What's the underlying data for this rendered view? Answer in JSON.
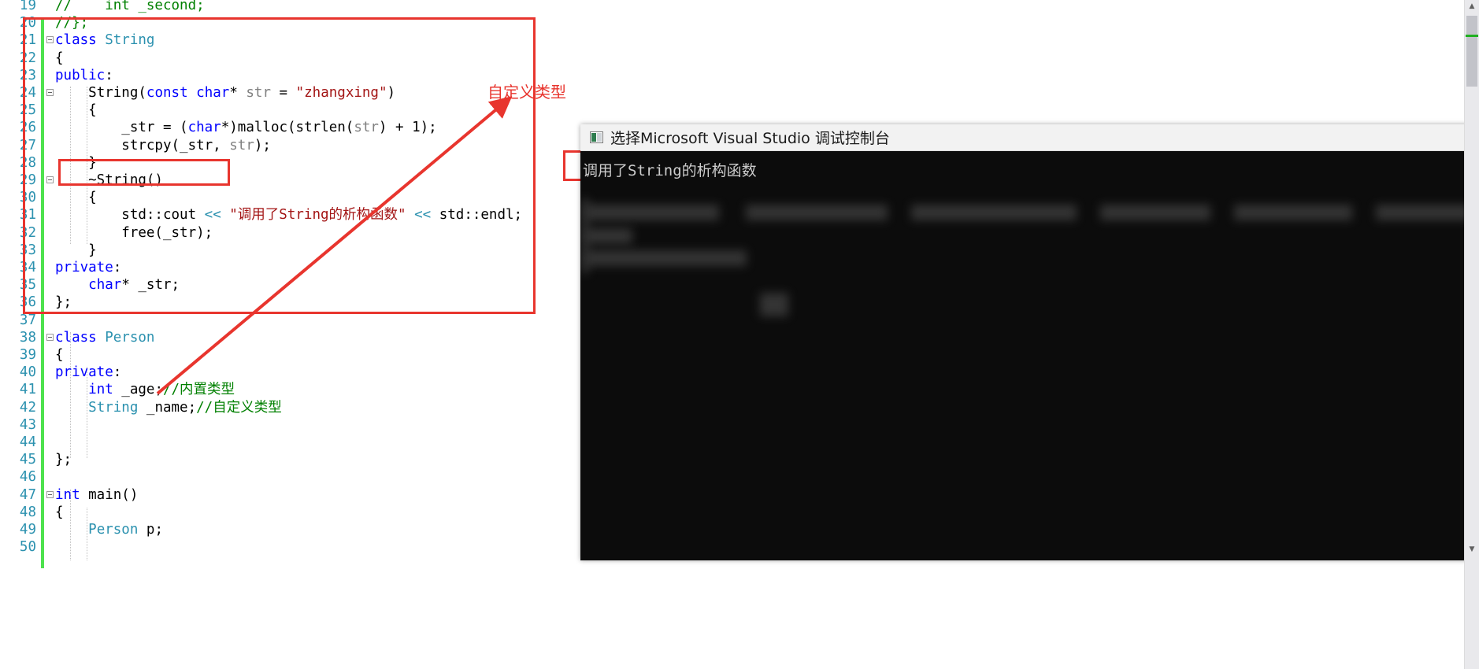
{
  "editor": {
    "name": "visual-studio-code-editor",
    "first_visible_line": 19,
    "lines": [
      {
        "num": "19",
        "text": "//    int _second;",
        "tokens": [
          {
            "t": "//    int _second;",
            "c": "cmt"
          }
        ],
        "fold": false,
        "changed": false
      },
      {
        "num": "20",
        "text": "//};",
        "tokens": [
          {
            "t": "//};",
            "c": "cmt"
          }
        ],
        "fold": false,
        "changed": false
      },
      {
        "num": "21",
        "text": "class String",
        "tokens": [
          {
            "t": "class ",
            "c": "kw"
          },
          {
            "t": "String",
            "c": "type"
          }
        ],
        "fold": true,
        "changed": true
      },
      {
        "num": "22",
        "text": "{",
        "tokens": [
          {
            "t": "{",
            "c": "plain"
          }
        ],
        "fold": false,
        "changed": true
      },
      {
        "num": "23",
        "text": "public:",
        "tokens": [
          {
            "t": "public",
            "c": "kw"
          },
          {
            "t": ":",
            "c": "plain"
          }
        ],
        "fold": false,
        "changed": true
      },
      {
        "num": "24",
        "text": "    String(const char* str = \"zhangxing\")",
        "tokens": [
          {
            "t": "    ",
            "c": "plain"
          },
          {
            "t": "String",
            "c": "plain"
          },
          {
            "t": "(",
            "c": "plain"
          },
          {
            "t": "const",
            "c": "kw"
          },
          {
            "t": " ",
            "c": "plain"
          },
          {
            "t": "char",
            "c": "kw"
          },
          {
            "t": "* ",
            "c": "plain"
          },
          {
            "t": "str",
            "c": "param"
          },
          {
            "t": " = ",
            "c": "plain"
          },
          {
            "t": "\"zhangxing\"",
            "c": "str"
          },
          {
            "t": ")",
            "c": "plain"
          }
        ],
        "fold": true,
        "changed": true
      },
      {
        "num": "25",
        "text": "    {",
        "tokens": [
          {
            "t": "    {",
            "c": "plain"
          }
        ],
        "fold": false,
        "changed": true
      },
      {
        "num": "26",
        "text": "        _str = (char*)malloc(strlen(str) + 1);",
        "tokens": [
          {
            "t": "        _str = (",
            "c": "plain"
          },
          {
            "t": "char",
            "c": "kw"
          },
          {
            "t": "*)malloc(strlen(",
            "c": "plain"
          },
          {
            "t": "str",
            "c": "param"
          },
          {
            "t": ") + 1);",
            "c": "plain"
          }
        ],
        "fold": false,
        "changed": true
      },
      {
        "num": "27",
        "text": "        strcpy(_str, str);",
        "tokens": [
          {
            "t": "        strcpy(_str, ",
            "c": "plain"
          },
          {
            "t": "str",
            "c": "param"
          },
          {
            "t": ");",
            "c": "plain"
          }
        ],
        "fold": false,
        "changed": true
      },
      {
        "num": "28",
        "text": "    }",
        "tokens": [
          {
            "t": "    }",
            "c": "plain"
          }
        ],
        "fold": false,
        "changed": true
      },
      {
        "num": "29",
        "text": "    ~String()",
        "tokens": [
          {
            "t": "    ~String()",
            "c": "plain"
          }
        ],
        "fold": true,
        "changed": true
      },
      {
        "num": "30",
        "text": "    {",
        "tokens": [
          {
            "t": "    {",
            "c": "plain"
          }
        ],
        "fold": false,
        "changed": true
      },
      {
        "num": "31",
        "text": "        std::cout << \"调用了String的析构函数\" << std::endl;",
        "tokens": [
          {
            "t": "        std::cout ",
            "c": "plain"
          },
          {
            "t": "<< ",
            "c": "type"
          },
          {
            "t": "\"调用了String的析构函数\"",
            "c": "str"
          },
          {
            "t": " << ",
            "c": "type"
          },
          {
            "t": "std::endl;",
            "c": "plain"
          }
        ],
        "fold": false,
        "changed": true
      },
      {
        "num": "32",
        "text": "        free(_str);",
        "tokens": [
          {
            "t": "        free(_str);",
            "c": "plain"
          }
        ],
        "fold": false,
        "changed": true
      },
      {
        "num": "33",
        "text": "    }",
        "tokens": [
          {
            "t": "    }",
            "c": "plain"
          }
        ],
        "fold": false,
        "changed": true
      },
      {
        "num": "34",
        "text": "private:",
        "tokens": [
          {
            "t": "private",
            "c": "kw"
          },
          {
            "t": ":",
            "c": "plain"
          }
        ],
        "fold": false,
        "changed": true
      },
      {
        "num": "35",
        "text": "    char* _str;",
        "tokens": [
          {
            "t": "    ",
            "c": "plain"
          },
          {
            "t": "char",
            "c": "kw"
          },
          {
            "t": "* _str;",
            "c": "plain"
          }
        ],
        "fold": false,
        "changed": true
      },
      {
        "num": "36",
        "text": "};",
        "tokens": [
          {
            "t": "};",
            "c": "plain"
          }
        ],
        "fold": false,
        "changed": true
      },
      {
        "num": "37",
        "text": "",
        "tokens": [],
        "fold": false,
        "changed": true
      },
      {
        "num": "38",
        "text": "class Person",
        "tokens": [
          {
            "t": "class ",
            "c": "kw"
          },
          {
            "t": "Person",
            "c": "type"
          }
        ],
        "fold": true,
        "changed": true
      },
      {
        "num": "39",
        "text": "{",
        "tokens": [
          {
            "t": "{",
            "c": "plain"
          }
        ],
        "fold": false,
        "changed": true
      },
      {
        "num": "40",
        "text": "private:",
        "tokens": [
          {
            "t": "private",
            "c": "kw"
          },
          {
            "t": ":",
            "c": "plain"
          }
        ],
        "fold": false,
        "changed": true
      },
      {
        "num": "41",
        "text": "    int _age;//内置类型",
        "tokens": [
          {
            "t": "    ",
            "c": "plain"
          },
          {
            "t": "int",
            "c": "kw"
          },
          {
            "t": " _age;",
            "c": "plain"
          },
          {
            "t": "//内置类型",
            "c": "cmt"
          }
        ],
        "fold": false,
        "changed": true
      },
      {
        "num": "42",
        "text": "    String _name;//自定义类型",
        "tokens": [
          {
            "t": "    ",
            "c": "plain"
          },
          {
            "t": "String",
            "c": "type"
          },
          {
            "t": " _name;",
            "c": "plain"
          },
          {
            "t": "//自定义类型",
            "c": "cmt"
          }
        ],
        "fold": false,
        "changed": true
      },
      {
        "num": "43",
        "text": "",
        "tokens": [],
        "fold": false,
        "changed": true
      },
      {
        "num": "44",
        "text": "",
        "tokens": [],
        "fold": false,
        "changed": true
      },
      {
        "num": "45",
        "text": "};",
        "tokens": [
          {
            "t": "};",
            "c": "plain"
          }
        ],
        "fold": false,
        "changed": true
      },
      {
        "num": "46",
        "text": "",
        "tokens": [],
        "fold": false,
        "changed": true
      },
      {
        "num": "47",
        "text": "int main()",
        "tokens": [
          {
            "t": "int",
            "c": "kw"
          },
          {
            "t": " main()",
            "c": "plain"
          }
        ],
        "fold": true,
        "changed": true
      },
      {
        "num": "48",
        "text": "{",
        "tokens": [
          {
            "t": "{",
            "c": "plain"
          }
        ],
        "fold": false,
        "changed": true
      },
      {
        "num": "49",
        "text": "    Person p;",
        "tokens": [
          {
            "t": "    ",
            "c": "plain"
          },
          {
            "t": "Person",
            "c": "type"
          },
          {
            "t": " p;",
            "c": "plain"
          }
        ],
        "fold": false,
        "changed": true
      },
      {
        "num": "50",
        "text": "",
        "tokens": [],
        "fold": false,
        "changed": true
      }
    ]
  },
  "annotations": {
    "custom_type_label": "自定义类型",
    "highlight_color": "#e8352e"
  },
  "console": {
    "title": "选择Microsoft Visual Studio 调试控制台",
    "output_line": "调用了String的析构函数",
    "background_color": "#0c0c0c"
  },
  "scrollbar": {
    "up_arrow": "▲",
    "down_arrow": "▼"
  }
}
